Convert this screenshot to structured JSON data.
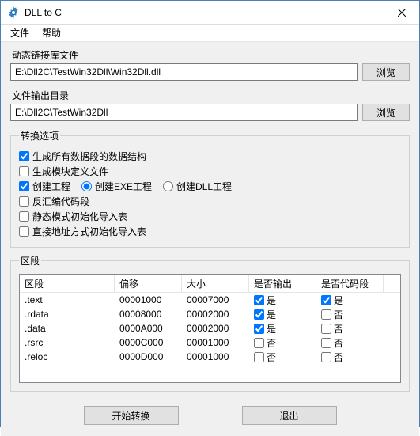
{
  "titlebar": {
    "title": "DLL to C",
    "close": "✕"
  },
  "menubar": {
    "file": "文件",
    "help": "帮助"
  },
  "dll_path": {
    "label": "动态链接库文件",
    "value": "E:\\Dll2C\\TestWin32Dll\\Win32Dll.dll",
    "browse": "浏览"
  },
  "out_path": {
    "label": "文件输出目录",
    "value": "E:\\Dll2C\\TestWin32Dll",
    "browse": "浏览"
  },
  "options": {
    "legend": "转换选项",
    "gen_struct": "生成所有数据段的数据结构",
    "gen_moddef": "生成模块定义文件",
    "create_proj": "创建工程",
    "create_exe": "创建EXE工程",
    "create_dll": "创建DLL工程",
    "deasm_code": "反汇编代码段",
    "static_init": "静态模式初始化导入表",
    "direct_addr": "直接地址方式初始化导入表"
  },
  "sections": {
    "legend": "区段",
    "headers": {
      "name": "区段",
      "offset": "偏移",
      "size": "大小",
      "output": "是否输出",
      "codeseg": "是否代码段"
    },
    "yes": "是",
    "no": "否",
    "rows": [
      {
        "name": ".text",
        "offset": "00001000",
        "size": "00007000",
        "output": true,
        "codeseg": true
      },
      {
        "name": ".rdata",
        "offset": "00008000",
        "size": "00002000",
        "output": true,
        "codeseg": false
      },
      {
        "name": ".data",
        "offset": "0000A000",
        "size": "00002000",
        "output": true,
        "codeseg": false
      },
      {
        "name": ".rsrc",
        "offset": "0000C000",
        "size": "00001000",
        "output": false,
        "codeseg": false
      },
      {
        "name": ".reloc",
        "offset": "0000D000",
        "size": "00001000",
        "output": false,
        "codeseg": false
      }
    ]
  },
  "buttons": {
    "start": "开始转换",
    "exit": "退出"
  }
}
